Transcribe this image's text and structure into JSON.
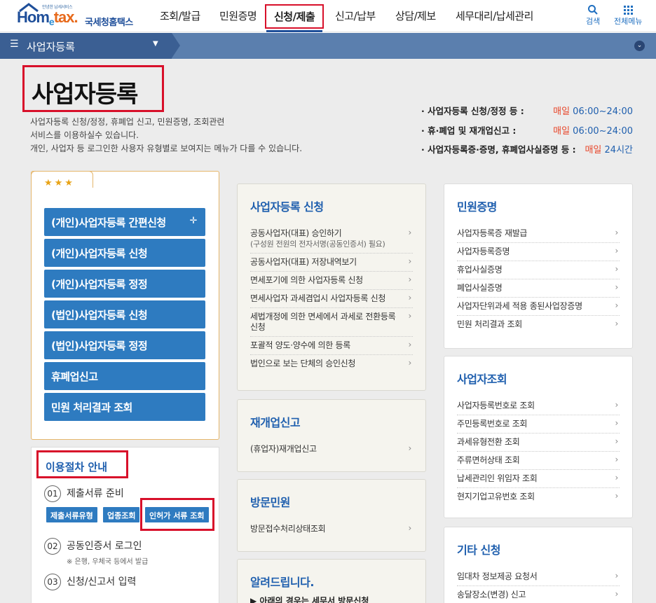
{
  "header": {
    "logo_slogan": "안녕한 납세서비스",
    "logo_home": "Hom",
    "logo_e": "e",
    "logo_tax": "tax.",
    "logo_name": "국세청홈택스",
    "menu": [
      "조회/발급",
      "민원증명",
      "신청/제출",
      "신고/납부",
      "상담/제보",
      "세무대리/납세관리"
    ],
    "search_label": "검색",
    "allmenu_label": "전체메뉴"
  },
  "subbar": {
    "label": "사업자등록"
  },
  "page": {
    "title": "사업자등록",
    "desc1": "사업자등록 신청/정정, 휴폐업 신고, 민원증명, 조회관련",
    "desc2": "서비스를 이용하실수 있습니다.",
    "desc3": "개인, 사업자 등 로그인한 사용자 유형별로 보여지는 메뉴가 다를 수 있습니다."
  },
  "hours": [
    {
      "label": "· 사업자등록 신청/정정 등 :",
      "day": "매일",
      "time": " 06:00~24:00"
    },
    {
      "label": "· 휴·폐업 및 재개업신고 :",
      "day": "매일",
      "time": " 06:00~24:00"
    },
    {
      "label": "· 사업자등록증·증명, 휴폐업사실증명 등 :",
      "day": "매일",
      "time": " 24시간"
    }
  ],
  "quick": {
    "stars": "★★★",
    "buttons": [
      "(개인)사업자등록 간편신청",
      "(개인)사업자등록 신청",
      "(개인)사업자등록 정정",
      "(법인)사업자등록 신청",
      "(법인)사업자등록 정정",
      "휴폐업신고",
      "민원 처리결과 조회"
    ],
    "plus": "✛"
  },
  "procedure": {
    "title": "이용절차 안내",
    "steps": [
      {
        "num": "01",
        "label": "제출서류 준비"
      },
      {
        "num": "02",
        "label": "공동인증서 로그인"
      },
      {
        "num": "03",
        "label": "신청/신고서 입력"
      }
    ],
    "note": "※ 은행, 우체국 등에서 발급",
    "buttons": [
      "제출서류유형",
      "업종조회",
      "인허가 서류 조회"
    ]
  },
  "cards": {
    "reg": {
      "title": "사업자등록 신청",
      "items": [
        {
          "label": "공동사업자(대표) 승인하기",
          "note": "(구성원 전원의 전자서명(공동인증서) 필요)"
        },
        {
          "label": "공동사업자(대표) 저장내역보기"
        },
        {
          "label": "면세포기에 의한 사업자등록 신청"
        },
        {
          "label": "면세사업자 과세겸업시 사업자등록 신청"
        },
        {
          "label": "세법개정에 의한 면세에서 과세로 전환등록 신청"
        },
        {
          "label": "포괄적 양도·양수에 의한 등록"
        },
        {
          "label": "법인으로 보는 단체의 승인신청"
        }
      ]
    },
    "reopen": {
      "title": "재개업신고",
      "items": [
        {
          "label": "(휴업자)재개업신고"
        }
      ]
    },
    "visit": {
      "title": "방문민원",
      "items": [
        {
          "label": "방문접수처리상태조회"
        }
      ]
    },
    "notice": {
      "title": "알려드립니다.",
      "line": "▶ 아래의 경우는 세무서 방문신청"
    },
    "cert": {
      "title": "민원증명",
      "items": [
        {
          "label": "사업자등록증 재발급"
        },
        {
          "label": "사업자등록증명"
        },
        {
          "label": "휴업사실증명"
        },
        {
          "label": "폐업사실증명"
        },
        {
          "label": "사업자단위과세 적용 종된사업장증명"
        },
        {
          "label": "민원 처리결과 조회"
        }
      ]
    },
    "lookup": {
      "title": "사업자조회",
      "items": [
        {
          "label": "사업자등록번호로 조회"
        },
        {
          "label": "주민등록번호로 조회"
        },
        {
          "label": "과세유형전환 조회"
        },
        {
          "label": "주류면허상태 조회"
        },
        {
          "label": "납세관리인 위임자 조회"
        },
        {
          "label": "현지기업고유번호 조회"
        }
      ]
    },
    "etc": {
      "title": "기타 신청",
      "items": [
        {
          "label": "임대차 정보제공 요청서"
        },
        {
          "label": "송달장소(변경) 신고"
        }
      ]
    }
  },
  "chevron": "›"
}
